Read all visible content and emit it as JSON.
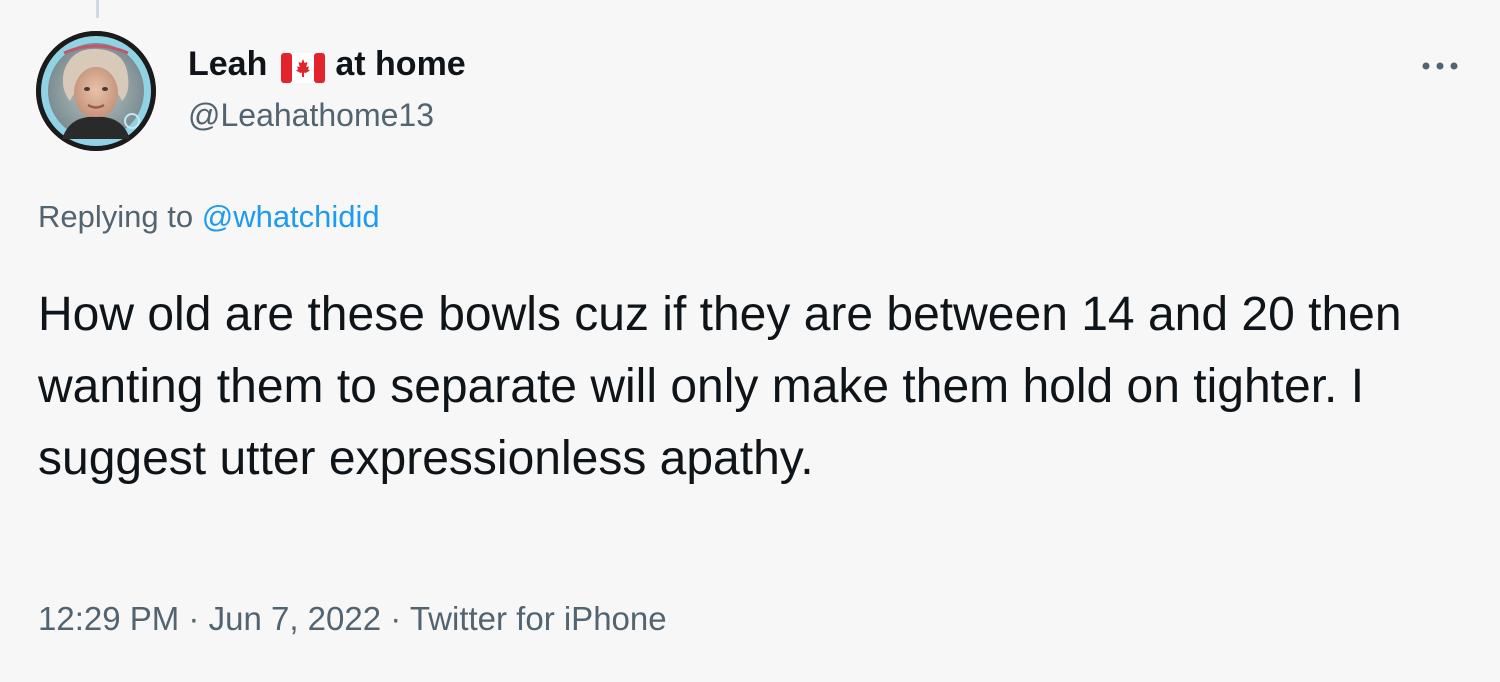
{
  "tweet": {
    "author": {
      "name_prefix": "Leah",
      "flag_icon": "canada-flag-icon",
      "name_suffix": "at home",
      "handle": "@Leahathome13"
    },
    "reply": {
      "prefix": "Replying to",
      "mention": "@whatchidid"
    },
    "text": "How old are these bowls cuz if they are between 14 and 20 then wanting them to separate will only make them hold on tighter. I suggest utter expressionless apathy.",
    "timestamp": {
      "time": "12:29 PM",
      "separator": "·",
      "date": "Jun 7, 2022",
      "source": "Twitter for iPhone"
    }
  },
  "colors": {
    "background": "#f7f7f7",
    "text_primary": "#0f1419",
    "text_secondary": "#536471",
    "link": "#1d9bf0",
    "flag_red": "#e2232b"
  },
  "icons": {
    "more": "more-options-icon"
  }
}
